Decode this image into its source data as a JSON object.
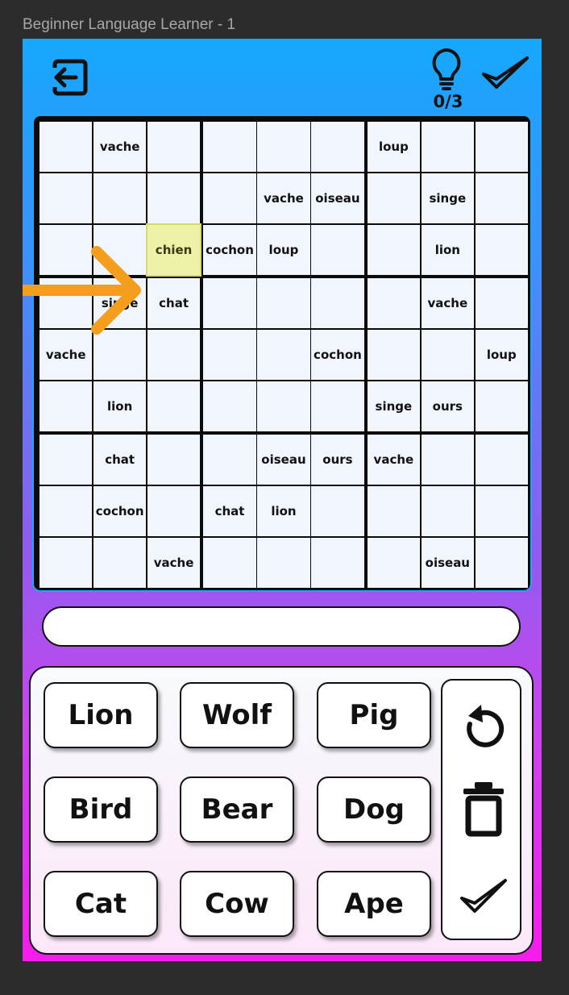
{
  "window_title": "Beginner Language Learner - 1",
  "header": {
    "exit_icon": "exit-icon",
    "hint_icon": "lightbulb-icon",
    "hint_count": "0/3",
    "submit_icon": "checkmark-icon"
  },
  "board": {
    "selected": [
      2,
      2
    ],
    "cells": [
      [
        "",
        "vache",
        "",
        "",
        "",
        "",
        "loup",
        "",
        ""
      ],
      [
        "",
        "",
        "",
        "",
        "vache",
        "oiseau",
        "",
        "singe",
        ""
      ],
      [
        "",
        "",
        "chien",
        "cochon",
        "loup",
        "",
        "",
        "lion",
        ""
      ],
      [
        "",
        "singe",
        "chat",
        "",
        "",
        "",
        "",
        "vache",
        ""
      ],
      [
        "vache",
        "",
        "",
        "",
        "",
        "cochon",
        "",
        "",
        "loup"
      ],
      [
        "",
        "lion",
        "",
        "",
        "",
        "",
        "singe",
        "ours",
        ""
      ],
      [
        "",
        "chat",
        "",
        "",
        "oiseau",
        "ours",
        "vache",
        "",
        ""
      ],
      [
        "",
        "cochon",
        "",
        "chat",
        "lion",
        "",
        "",
        "",
        ""
      ],
      [
        "",
        "",
        "vache",
        "",
        "",
        "",
        "",
        "oiseau",
        ""
      ]
    ]
  },
  "answer": {
    "value": ""
  },
  "word_buttons": [
    "Lion",
    "Wolf",
    "Pig",
    "Bird",
    "Bear",
    "Dog",
    "Cat",
    "Cow",
    "Ape"
  ],
  "actions": {
    "undo_icon": "undo-icon",
    "delete_icon": "trash-icon",
    "confirm_icon": "checkmark-icon"
  },
  "colors": {
    "gradient_top": "#16a8fd",
    "gradient_bottom": "#f51cec",
    "arrow": "#f59e1e",
    "selected_cell": "#eef2a8"
  }
}
